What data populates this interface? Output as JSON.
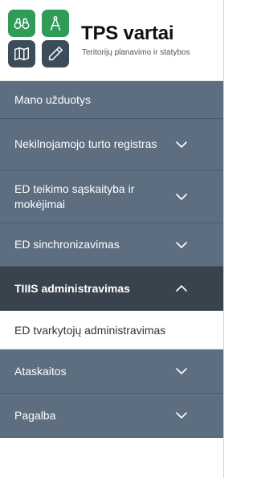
{
  "header": {
    "title": "TPS vartai",
    "subtitle": "Teritorijų planavimo ir statybos"
  },
  "logo": {
    "tiles": [
      "binoculars-icon",
      "drafting-compass-icon",
      "map-icon",
      "pen-icon"
    ],
    "colors": {
      "green": "#2e9b57",
      "dark": "#3d4c5a"
    }
  },
  "menu": {
    "items": [
      {
        "label": "Mano užduotys"
      },
      {
        "label": "Nekilnojamojo turto registras"
      },
      {
        "label": "ED teikimo sąskaityba ir mokėjimai"
      },
      {
        "label": "ED sinchronizavimas"
      },
      {
        "label": "TIIIS administravimas"
      },
      {
        "label": "Ataskaitos"
      },
      {
        "label": "Pagalba"
      }
    ],
    "submenu": {
      "label": "ED tvarkytojų administravimas"
    }
  },
  "colors": {
    "menu_bg": "#5d6e80",
    "menu_active_bg": "#39434d",
    "text_light": "#ffffff"
  }
}
